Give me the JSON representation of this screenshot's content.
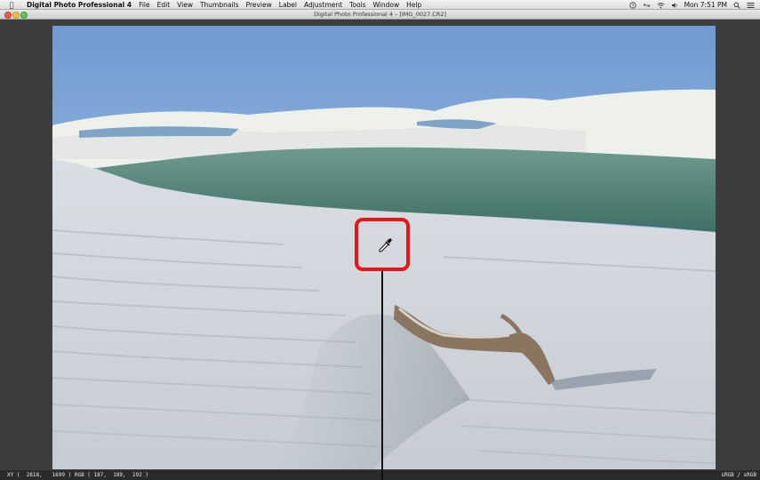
{
  "menubar": {
    "app_name": "Digital Photo Professional 4",
    "items": [
      "File",
      "Edit",
      "View",
      "Thumbnails",
      "Preview",
      "Label",
      "Adjustment",
      "Tools",
      "Window",
      "Help"
    ],
    "clock": "Mon 7:51 PM"
  },
  "window": {
    "title": "Digital Photo Professional 4 – [IMG_0027.CR2]"
  },
  "statusbar": {
    "readout": "XY (  2818,   1699 ) RGB ( 187,  189,  192 )",
    "colorspace": "sRGB / sRGB"
  },
  "colors": {
    "callout": "#e8141a",
    "workspace": "#3d3d3d",
    "statusbar": "#2b2b2b"
  },
  "icons": [
    "apple-icon",
    "clock-icon",
    "wifi-icon",
    "volume-icon",
    "spotlight-icon",
    "notification-list-icon",
    "eyedropper-icon"
  ]
}
